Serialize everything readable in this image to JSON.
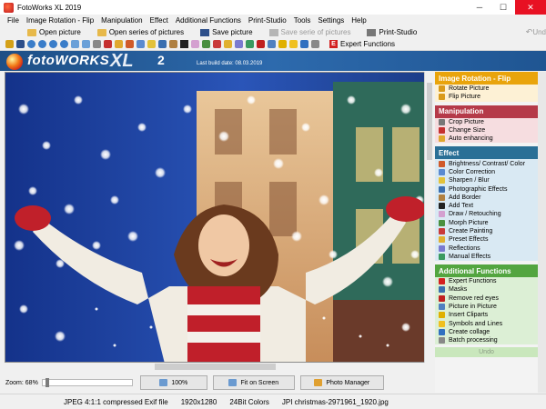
{
  "window": {
    "title": "FotoWorks XL 2019",
    "minimize": "─",
    "maximize": "☐",
    "close": "✕"
  },
  "menu": [
    "File",
    "Image Rotation - Flip",
    "Manipulation",
    "Effect",
    "Additional Functions",
    "Print-Studio",
    "Tools",
    "Settings",
    "Help"
  ],
  "toolbar": {
    "open_picture": "Open picture",
    "open_series": "Open series of pictures",
    "save_picture": "Save picture",
    "save_series": "Save serie of pictures",
    "print_studio": "Print-Studio",
    "undo": "Und",
    "expert_functions": "Expert Functions"
  },
  "banner": {
    "logo_main": "fotoWORKS",
    "logo_xl": "XL",
    "logo_num": "2",
    "build_date": "Last build date: 08.03.2019"
  },
  "panel": {
    "sections": [
      {
        "title": "Image Rotation - Flip",
        "color": "#e9a40c",
        "item_bg": "#fdf1d5",
        "items": [
          "Rotate Picture",
          "Flip Picture"
        ]
      },
      {
        "title": "Manipulation",
        "color": "#b53a49",
        "item_bg": "#f6dde0",
        "items": [
          "Crop Picture",
          "Change Size",
          "Auto enhancing"
        ]
      },
      {
        "title": "Effect",
        "color": "#2a6f96",
        "item_bg": "#d9e9f3",
        "items": [
          "Brightness/ Contrast/ Color",
          "Color Correction",
          "Sharpen / Blur",
          "Photographic Effects",
          "Add Border",
          "Add Text",
          "Draw / Retouching",
          "Morph Picture",
          "Create Painting",
          "Preset Effects",
          "Reflections",
          "Manual Effects"
        ]
      },
      {
        "title": "Additional Functions",
        "color": "#53a540",
        "item_bg": "#dcefd5",
        "items": [
          "Expert Functions",
          "Masks",
          "Remove red eyes",
          "Picture in Picture",
          "Insert Cliparts",
          "Symbols and Lines",
          "Create collage",
          "Batch processing"
        ]
      }
    ],
    "undo": "Undo"
  },
  "zoom": {
    "label": "Zoom: 68%",
    "btn_100": "100%",
    "btn_fit": "Fit on Screen",
    "btn_manager": "Photo Manager"
  },
  "status": {
    "format": "JPEG 4:1:1 compressed Exif file",
    "dimensions": "1920x1280",
    "colors": "24Bit Colors",
    "filename": "JPI christmas-2971961_1920.jpg"
  }
}
